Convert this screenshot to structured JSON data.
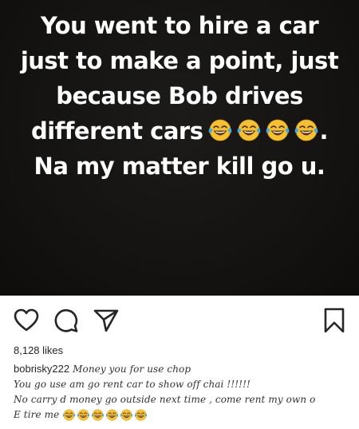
{
  "post": {
    "lines": [
      "You went to hire a car",
      "just to make a point, just",
      "because Bob drives",
      "different cars",
      "Na my matter kill go u."
    ],
    "line4_suffix": ".",
    "emoji_name": "face-with-tears-of-joy",
    "emoji_count_caption": 4
  },
  "actions": {
    "like_icon": "heart-icon",
    "comment_icon": "comment-icon",
    "share_icon": "paper-plane-icon",
    "save_icon": "bookmark-icon"
  },
  "likes": "8,128 likes",
  "comment": {
    "username": "bobrisky222",
    "line1": "Money you for use chop",
    "line2": "You go use am go rent car to show off chai !!!!!!",
    "line3": "No carry d money go outside next time , come rent my own o",
    "line4": "E tire me",
    "emoji_count_comment": 6
  },
  "colors": {
    "image_bg": "#141311",
    "text_white": "#ffffff",
    "icon_stroke": "#262626",
    "emoji_yellow": "#f5c131",
    "emoji_tear": "#4aa8e0"
  }
}
